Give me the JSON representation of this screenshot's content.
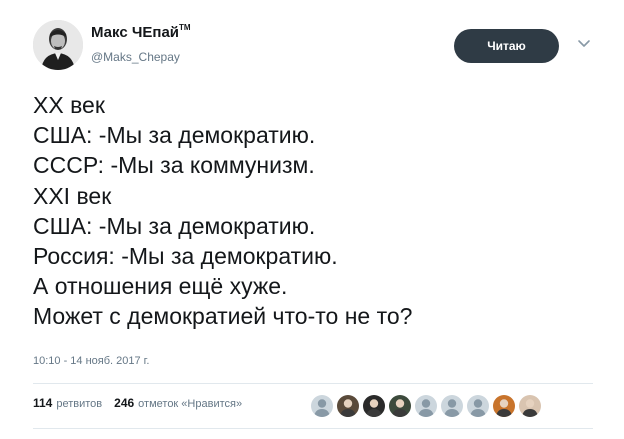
{
  "author": {
    "name": "Макс ЧЕпай",
    "name_mark": "TM",
    "handle": "@Maks_Chepay"
  },
  "follow_button": {
    "label": "Читаю"
  },
  "tweet": {
    "lines": [
      "XX век",
      "США: -Мы за демократию.",
      "СССР: -Мы за коммунизм.",
      "XXI век",
      "США: -Мы за демократию.",
      "Россия: -Мы за демократию.",
      "А отношения ещё хуже.",
      "Может с демократией что-то не то?"
    ],
    "timestamp": "10:10 - 14 нояб. 2017 г."
  },
  "stats": {
    "retweets_count": "114",
    "retweets_label": "ретвитов",
    "likes_count": "246",
    "likes_label": "отметок «Нравится»"
  },
  "likers": [
    {
      "icon": "default-egg-avatar",
      "color": "#b4bcc2"
    },
    {
      "icon": "photo-avatar",
      "color": "#5a4a3a"
    },
    {
      "icon": "photo-avatar",
      "color": "#2a2a2a"
    },
    {
      "icon": "photo-avatar",
      "color": "#3c4a3c"
    },
    {
      "icon": "default-egg-avatar",
      "color": "#b4bcc2"
    },
    {
      "icon": "default-egg-avatar",
      "color": "#b4bcc2"
    },
    {
      "icon": "default-egg-avatar",
      "color": "#b4bcc2"
    },
    {
      "icon": "photo-avatar",
      "color": "#c8742c"
    },
    {
      "icon": "photo-avatar",
      "color": "#d9c4b0"
    }
  ],
  "colors": {
    "follow_button_bg": "#2f3b45",
    "secondary_text": "#657786",
    "divider": "#e1e8ed"
  }
}
